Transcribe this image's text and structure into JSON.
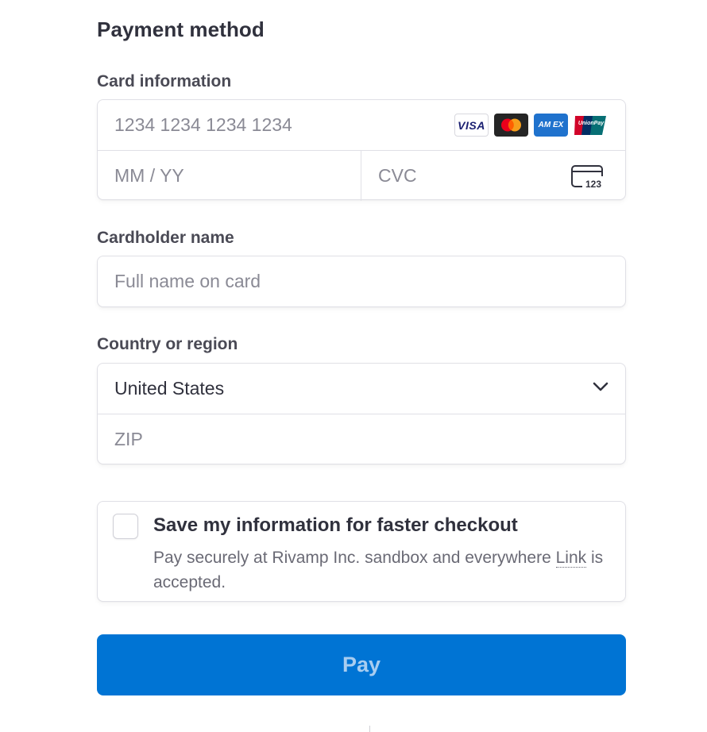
{
  "section_title": "Payment method",
  "card": {
    "label": "Card information",
    "number_placeholder": "1234 1234 1234 1234",
    "expiry_placeholder": "MM / YY",
    "cvc_placeholder": "CVC",
    "cvc_icon_text": "123",
    "brands": {
      "visa": "VISA",
      "amex": "AM EX",
      "unionpay": "UnionPay"
    }
  },
  "cardholder": {
    "label": "Cardholder name",
    "placeholder": "Full name on card"
  },
  "country": {
    "label": "Country or region",
    "selected": "United States",
    "zip_placeholder": "ZIP"
  },
  "save_info": {
    "title": "Save my information for faster checkout",
    "desc_before": "Pay securely at Rivamp Inc. sandbox and everywhere ",
    "desc_link": "Link",
    "desc_after": " is accepted."
  },
  "pay_button": {
    "label": "Pay"
  },
  "colors": {
    "accent": "#0074d4",
    "text": "#30313d",
    "placeholder": "#8a8a95",
    "border": "#e0e0e6"
  }
}
